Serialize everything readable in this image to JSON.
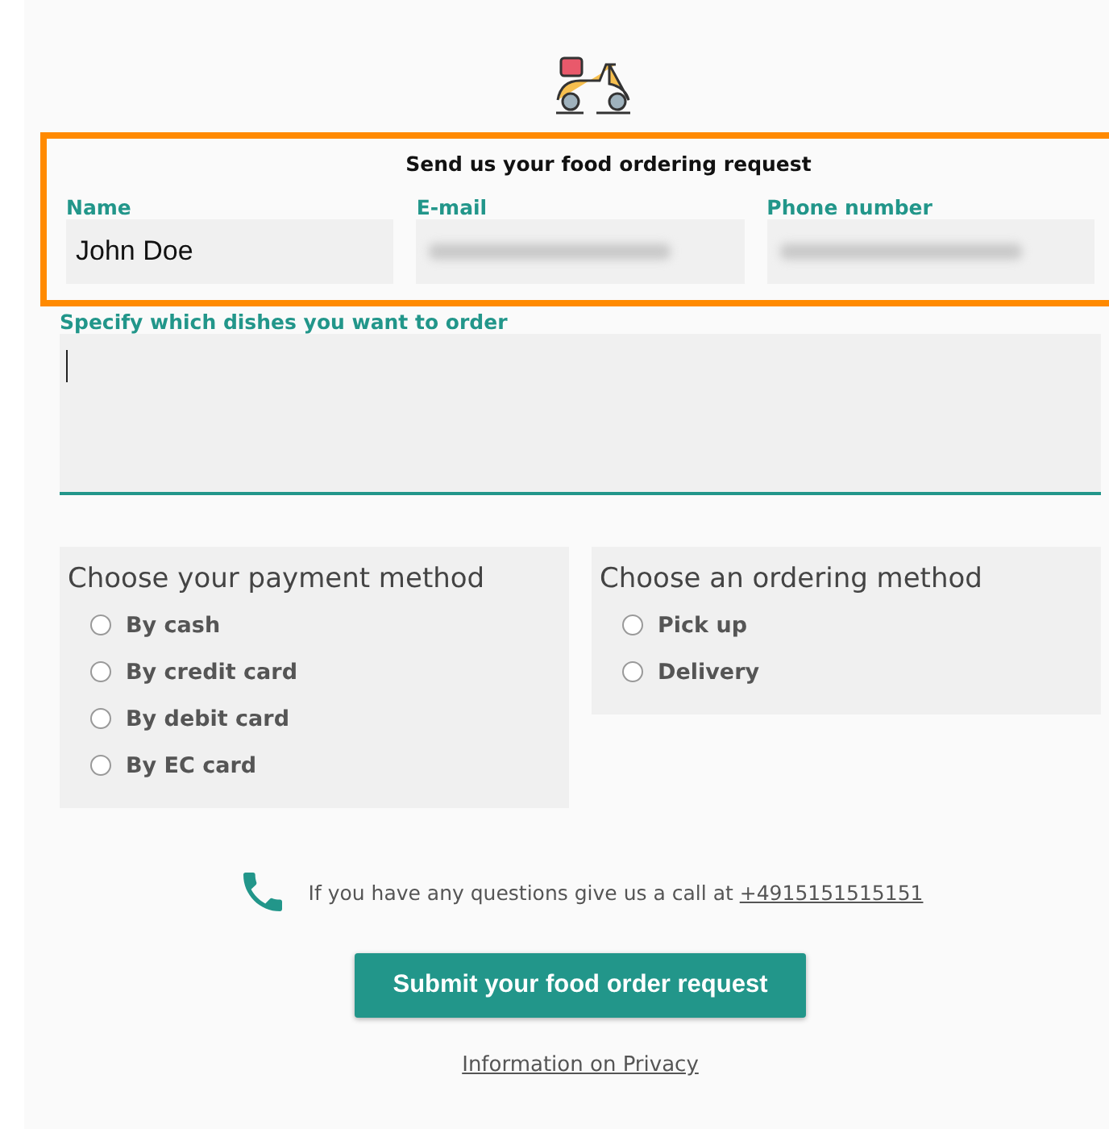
{
  "request_section": {
    "highlighted": true,
    "title": "Send us your food ordering request",
    "fields": [
      {
        "label": "Name",
        "value": "John Doe",
        "redacted": false
      },
      {
        "label": "E-mail",
        "redacted": true
      },
      {
        "label": "Phone number",
        "redacted": true
      }
    ]
  },
  "dishes": {
    "label": "Specify which dishes you want to order",
    "focused": true
  },
  "groups": [
    {
      "title": "Choose your payment method",
      "options": [
        {
          "label": "By cash",
          "selected": false
        },
        {
          "label": "By credit card",
          "selected": false
        },
        {
          "label": "By debit card",
          "selected": false
        },
        {
          "label": "By EC card",
          "selected": false
        }
      ]
    },
    {
      "title": "Choose an ordering method",
      "options": [
        {
          "label": "Pick up",
          "selected": false
        },
        {
          "label": "Delivery",
          "selected": false
        }
      ]
    }
  ],
  "contact": {
    "text": "If you have any questions give us a call at",
    "phone": "+4915151515151"
  },
  "submit": "Submit your food order request",
  "privacy_link": "Information on Privacy"
}
